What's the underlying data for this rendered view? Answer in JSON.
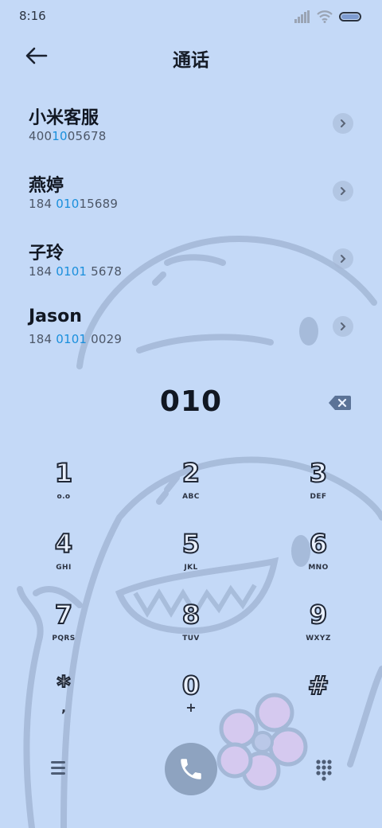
{
  "status_bar": {
    "time": "8:16"
  },
  "header": {
    "title": "通话"
  },
  "contacts": [
    {
      "name": "小米客服",
      "number": [
        "400",
        "10",
        "05678"
      ]
    },
    {
      "name": "燕婷",
      "number": [
        "184 ",
        "010",
        "15689"
      ]
    },
    {
      "name": "子玲",
      "number": [
        "184 ",
        "0101",
        " 5678"
      ]
    },
    {
      "name": "Jason",
      "number": [
        "184 ",
        "0101",
        " 0029"
      ]
    }
  ],
  "dialer": {
    "input": "010"
  },
  "keypad": [
    {
      "digit": "1",
      "letters": "o.o"
    },
    {
      "digit": "2",
      "letters": "ABC"
    },
    {
      "digit": "3",
      "letters": "DEF"
    },
    {
      "digit": "4",
      "letters": "GHI"
    },
    {
      "digit": "5",
      "letters": "JKL"
    },
    {
      "digit": "6",
      "letters": "MNO"
    },
    {
      "digit": "7",
      "letters": "PQRS"
    },
    {
      "digit": "8",
      "letters": "TUV"
    },
    {
      "digit": "9",
      "letters": "WXYZ"
    },
    {
      "digit": "*",
      "letters": ","
    },
    {
      "digit": "0",
      "letters": "+"
    },
    {
      "digit": "#",
      "letters": ""
    }
  ],
  "colors": {
    "background": "#c4d9f7",
    "highlight": "#1a8fdc",
    "call_button": "#8ea3c0"
  },
  "icons": {
    "back": "arrow-left-icon",
    "detail": "chevron-right-icon",
    "backspace": "backspace-icon",
    "menu": "menu-icon",
    "call": "phone-icon",
    "dialpad": "dialpad-icon"
  }
}
